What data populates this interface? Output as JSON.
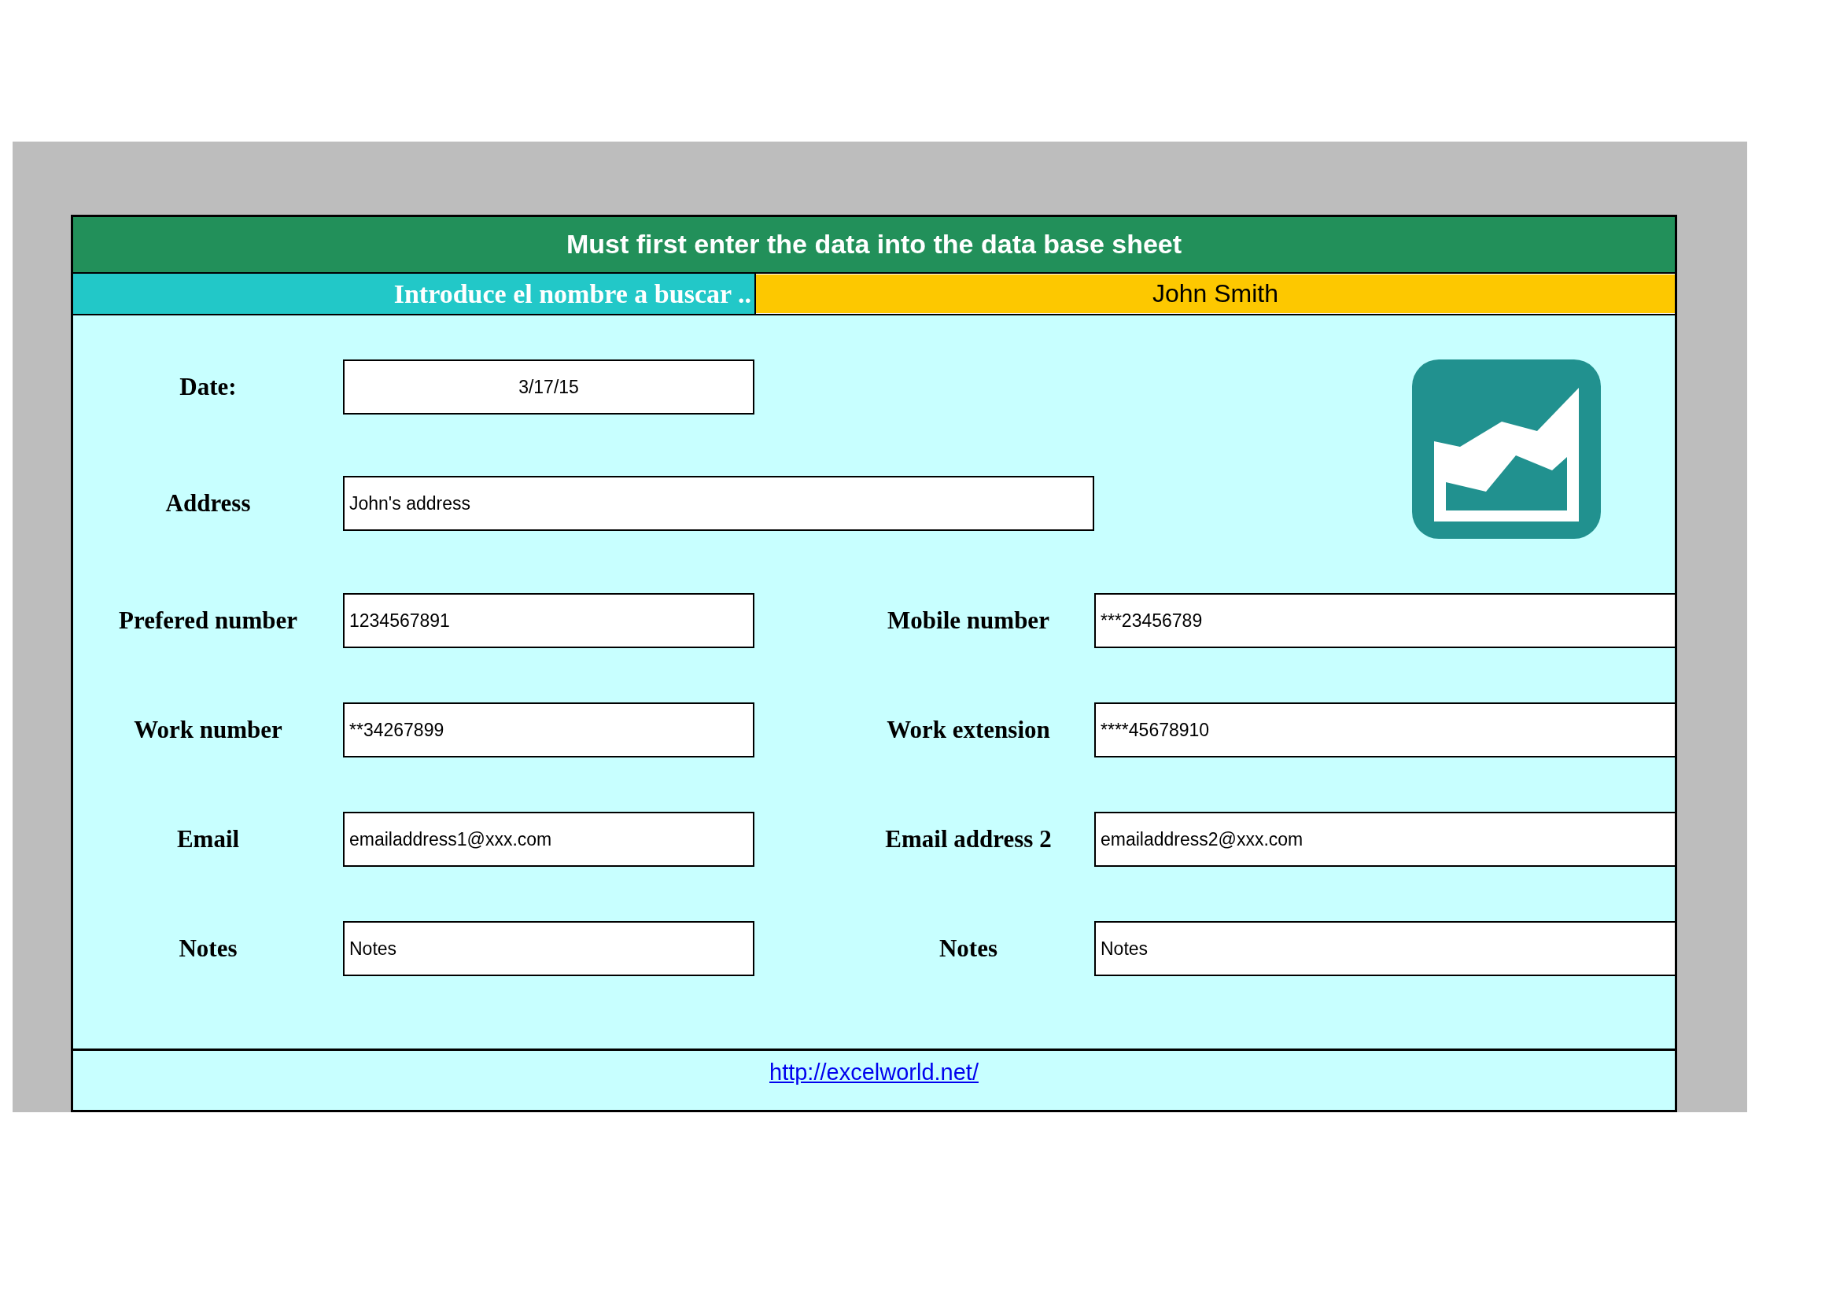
{
  "header": {
    "title": "Must first enter the data into the data base sheet"
  },
  "search": {
    "label": "Introduce el nombre a buscar ..",
    "value": "John Smith"
  },
  "rows": [
    {
      "fields": [
        {
          "kind": "centered",
          "label": "Date:",
          "value": "3/17/15"
        }
      ]
    },
    {
      "fields": [
        {
          "kind": "wide",
          "label": "Address",
          "value": "John's address"
        }
      ]
    },
    {
      "fields": [
        {
          "kind": "text",
          "label": "Prefered number",
          "value": "1234567891"
        },
        {
          "kind": "text",
          "label": "Mobile number",
          "value": "***23456789"
        }
      ]
    },
    {
      "fields": [
        {
          "kind": "text",
          "label": "Work number",
          "value": "**34267899"
        },
        {
          "kind": "text",
          "label": "Work extension",
          "value": "****45678910"
        }
      ]
    },
    {
      "fields": [
        {
          "kind": "text",
          "label": "Email",
          "value": "emailaddress1@xxx.com"
        },
        {
          "kind": "text",
          "label": "Email address 2",
          "value": "emailaddress2@xxx.com"
        }
      ]
    },
    {
      "fields": [
        {
          "kind": "text",
          "label": "Notes",
          "value": "Notes"
        },
        {
          "kind": "text",
          "label": "Notes",
          "value": "Notes"
        }
      ]
    }
  ],
  "footer": {
    "link": "http://excelworld.net/"
  }
}
